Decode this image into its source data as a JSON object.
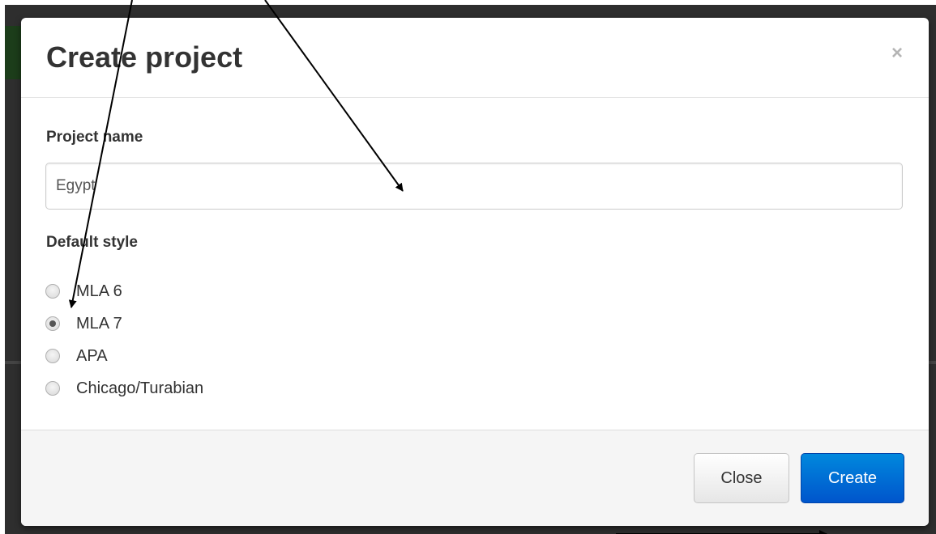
{
  "dialog": {
    "title": "Create project",
    "close_symbol": "×",
    "project_name_label": "Project name",
    "project_name_value": "Egypt",
    "default_style_label": "Default style",
    "styles": [
      {
        "label": "MLA 6",
        "selected": false
      },
      {
        "label": "MLA 7",
        "selected": true
      },
      {
        "label": "APA",
        "selected": false
      },
      {
        "label": "Chicago/Turabian",
        "selected": false
      }
    ],
    "close_button": "Close",
    "create_button": "Create"
  },
  "colors": {
    "primary": "#0066cc",
    "backdrop": "#2e2e2e",
    "annotation_arrow": "#000000"
  }
}
